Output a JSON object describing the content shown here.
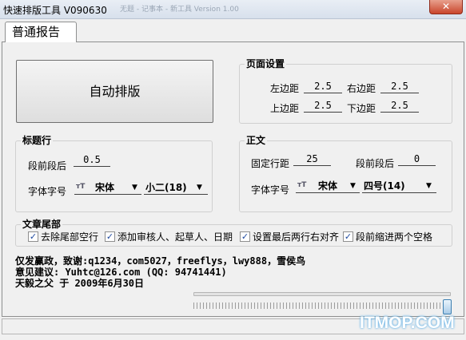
{
  "window": {
    "title": "快速排版工具 V090630",
    "ghost_title": "无题 - 记事本 - 新工具 Version 1.00",
    "close_label": "✕"
  },
  "tabs": [
    {
      "label": "普通报告",
      "active": true
    }
  ],
  "main": {
    "auto_format_label": "自动排版"
  },
  "page_setup": {
    "label": "页面设置",
    "left_margin": {
      "label": "左边距",
      "value": "2.5"
    },
    "right_margin": {
      "label": "右边距",
      "value": "2.5"
    },
    "top_margin": {
      "label": "上边距",
      "value": "2.5"
    },
    "bottom_margin": {
      "label": "下边距",
      "value": "2.5"
    }
  },
  "title_line": {
    "label": "标题行",
    "spacing": {
      "label": "段前段后",
      "value": "0.5"
    },
    "font_label": "字体字号",
    "font": {
      "icon": "font-type-icon",
      "value": "宋体"
    },
    "font_size": {
      "value": "小二(18)"
    }
  },
  "body_text": {
    "label": "正文",
    "line_spacing": {
      "label": "固定行距",
      "value": "25"
    },
    "para_spacing": {
      "label": "段前段后",
      "value": "0"
    },
    "font_label": "字体字号",
    "font": {
      "icon": "font-type-icon",
      "value": "宋体"
    },
    "font_size": {
      "value": "四号(14)"
    }
  },
  "tail": {
    "label": "文章尾部",
    "options": [
      {
        "label": "去除尾部空行",
        "checked": true
      },
      {
        "label": "添加审核人、起草人、日期",
        "checked": true
      },
      {
        "label": "设置最后两行右对齐",
        "checked": true
      },
      {
        "label": "段前缩进两个空格",
        "checked": true
      }
    ]
  },
  "credits": [
    "仅发赢政，致谢:q1234，com5027，freeflys，lwy888，雪侯鸟",
    "意见建议: Yuhtc@126.com (QQ: 94741441)",
    "天毅之父 于 2009年6月30日"
  ],
  "slider": {
    "level": 1.0
  },
  "watermark": "ITMOP.COM",
  "colors": {
    "checkmark": "#1f4aa0",
    "accent": "#3c7fb1"
  }
}
